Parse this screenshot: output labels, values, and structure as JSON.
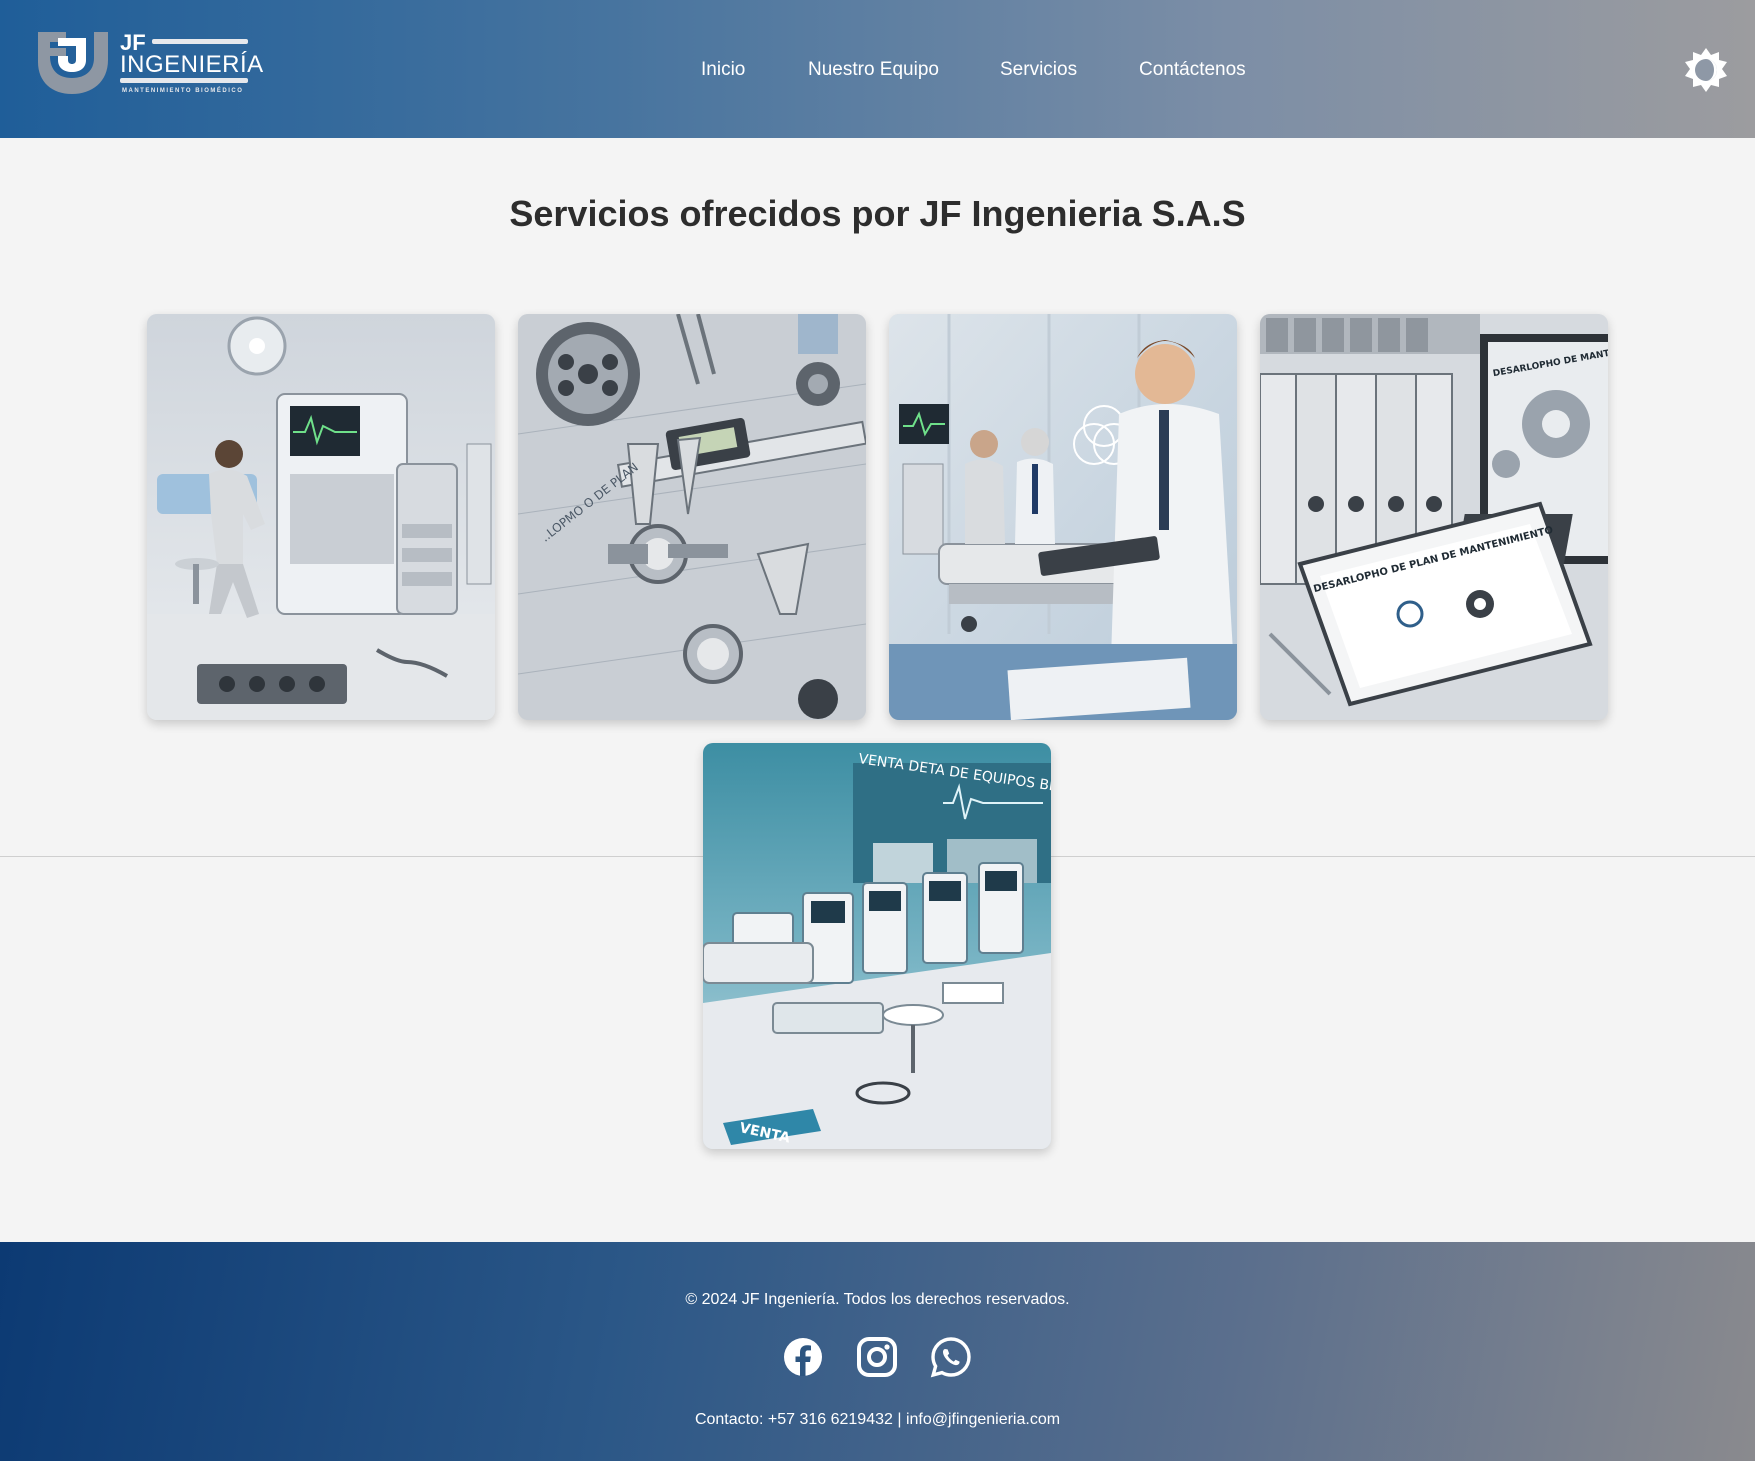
{
  "brand": {
    "initials": "JF",
    "name": "INGENIERÍA",
    "tagline": "MANTENIMIENTO BIOMÉDICO",
    "colors": {
      "primary": "#1f5e99",
      "footer": "#0c3a73",
      "text_dark": "#2d2d2d"
    }
  },
  "nav": {
    "items": [
      {
        "label": "Inicio"
      },
      {
        "label": "Nuestro Equipo"
      },
      {
        "label": "Servicios"
      },
      {
        "label": "Contáctenos"
      }
    ],
    "theme_toggle_icon": "sun-moon-icon"
  },
  "main": {
    "title": "Servicios ofrecidos por JF Ingenieria S.A.S",
    "cards": [
      {
        "image": "biomedical-technician-maintenance-illustration",
        "sign": ""
      },
      {
        "image": "calipers-and-precision-tools-illustration",
        "sign": "..LOPMO O DE PLAN"
      },
      {
        "image": "doctor-with-clipboard-and-patient-illustration",
        "sign": ""
      },
      {
        "image": "maintenance-plan-binders-and-laptop-illustration",
        "sign": "DESARLOPHO DE PLAN DE MANTENIMIENTO",
        "screen": "DESARLOPHO DE MANTI E INPLEENTATCON DOCU"
      },
      {
        "image": "biomedical-equipment-sales-showroom-illustration",
        "sign": "VENTA DETA DE EQUIPOS BIOMEDIODIDA",
        "label": "VENTA"
      }
    ]
  },
  "footer": {
    "copyright": "© 2024 JF Ingeniería. Todos los derechos reservados.",
    "social": [
      "facebook-icon",
      "instagram-icon",
      "whatsapp-icon"
    ],
    "contact": "Contacto: +57 316 6219432 | info@jfingenieria.com"
  }
}
